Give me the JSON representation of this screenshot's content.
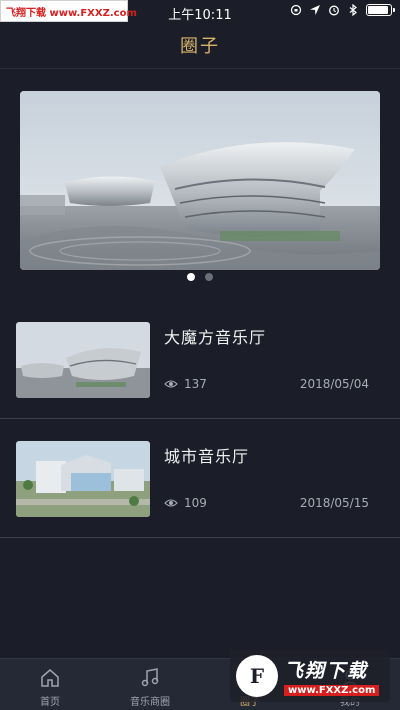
{
  "watermark": {
    "top_text": "飞翔下载 www.FXXZ.com",
    "logo_letter": "F",
    "brand": "飞翔下载",
    "url": "www.FXXZ.com"
  },
  "status_bar": {
    "time": "上午10:11",
    "battery_level": 0.9
  },
  "header": {
    "title": "圈子"
  },
  "banner": {
    "image": "concert-hall-architecture-photo",
    "page_count": 2,
    "active_page": 0
  },
  "list": {
    "items": [
      {
        "title": "大魔方音乐厅",
        "views": "137",
        "date": "2018/05/04",
        "thumb": "music-hall-1"
      },
      {
        "title": "城市音乐厅",
        "views": "109",
        "date": "2018/05/15",
        "thumb": "music-hall-2"
      }
    ]
  },
  "tab_bar": {
    "tabs": [
      {
        "label": "首页",
        "icon": "home-icon"
      },
      {
        "label": "音乐商圈",
        "icon": "music-note-icon"
      },
      {
        "label": "圈子",
        "icon": "circle-icon",
        "active": true
      },
      {
        "label": "我的",
        "icon": "user-icon"
      }
    ]
  },
  "colors": {
    "background": "#1b1e28",
    "accent": "#d8b36a",
    "tab_bar": "#252936"
  }
}
